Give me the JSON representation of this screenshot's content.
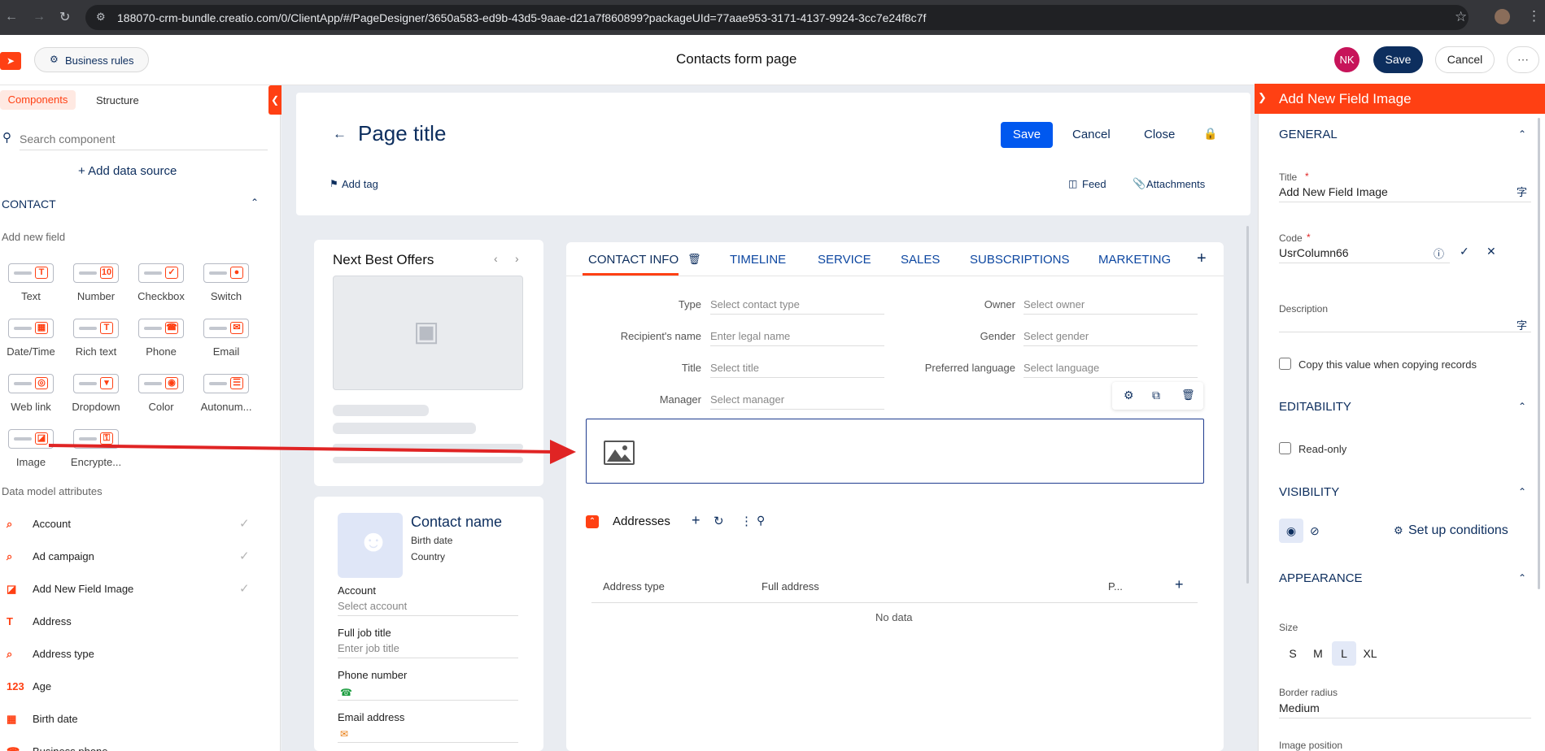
{
  "browser": {
    "url": "188070-crm-bundle.creatio.com/0/ClientApp/#/PageDesigner/3650a583-ed9b-43d5-9aae-d21a7f860899?packageUId=77aae953-3171-4137-9924-3cc7e24f8c7f"
  },
  "header": {
    "business_rules": "Business rules",
    "title": "Contacts form page",
    "avatar": "NK",
    "save": "Save",
    "cancel": "Cancel",
    "more": "⋯"
  },
  "left": {
    "tabs": [
      "Components",
      "Structure"
    ],
    "search_placeholder": "Search component",
    "add_data_source": "+ Add data source",
    "section": "CONTACT",
    "add_new_field": "Add new field",
    "components": [
      {
        "label": "Text",
        "mark": "T"
      },
      {
        "label": "Number",
        "mark": "10"
      },
      {
        "label": "Checkbox",
        "mark": "✓"
      },
      {
        "label": "Switch",
        "mark": "●"
      },
      {
        "label": "Date/Time",
        "mark": "▦"
      },
      {
        "label": "Rich text",
        "mark": "T"
      },
      {
        "label": "Phone",
        "mark": "☎"
      },
      {
        "label": "Email",
        "mark": "✉"
      },
      {
        "label": "Web link",
        "mark": "◎"
      },
      {
        "label": "Dropdown",
        "mark": "▾"
      },
      {
        "label": "Color",
        "mark": "◉"
      },
      {
        "label": "Autonum...",
        "mark": "☰"
      },
      {
        "label": "Image",
        "mark": "◪"
      },
      {
        "label": "Encrypte...",
        "mark": "⚿"
      }
    ],
    "data_model_title": "Data model attributes",
    "attributes": [
      {
        "icon": "⌕",
        "label": "Account",
        "checked": true
      },
      {
        "icon": "⌕",
        "label": "Ad campaign",
        "checked": true
      },
      {
        "icon": "◪",
        "label": "Add New Field Image",
        "checked": true
      },
      {
        "icon": "T",
        "label": "Address",
        "checked": false
      },
      {
        "icon": "⌕",
        "label": "Address type",
        "checked": false
      },
      {
        "icon": "123",
        "label": "Age",
        "checked": false
      },
      {
        "icon": "▦",
        "label": "Birth date",
        "checked": false
      },
      {
        "icon": "☎",
        "label": "Business phone",
        "checked": false
      }
    ]
  },
  "page": {
    "title": "Page title",
    "save": "Save",
    "cancel": "Cancel",
    "close": "Close",
    "add_tag": "Add tag",
    "feed": "Feed",
    "attachments": "Attachments",
    "nbo_title": "Next Best Offers",
    "contact_name": "Contact name",
    "birth_date": "Birth date",
    "country": "Country",
    "profile_fields": [
      {
        "label": "Account",
        "placeholder": "Select account"
      },
      {
        "label": "Full job title",
        "placeholder": "Enter job title"
      },
      {
        "label": "Phone number",
        "placeholder": ""
      },
      {
        "label": "Email address",
        "placeholder": ""
      }
    ],
    "tabs": [
      "CONTACT INFO",
      "TIMELINE",
      "SERVICE",
      "SALES",
      "SUBSCRIPTIONS",
      "MARKETING"
    ],
    "left_fields": [
      {
        "label": "Type",
        "placeholder": "Select contact type"
      },
      {
        "label": "Recipient's name",
        "placeholder": "Enter legal name"
      },
      {
        "label": "Title",
        "placeholder": "Select title"
      },
      {
        "label": "Manager",
        "placeholder": "Select manager"
      }
    ],
    "right_fields": [
      {
        "label": "Owner",
        "placeholder": "Select owner"
      },
      {
        "label": "Gender",
        "placeholder": "Select gender"
      },
      {
        "label": "Preferred language",
        "placeholder": "Select language"
      }
    ],
    "addresses_title": "Addresses",
    "columns": [
      "Address type",
      "Full address",
      "P..."
    ],
    "no_data": "No data"
  },
  "right": {
    "header": "Add New Field Image",
    "general": "GENERAL",
    "title_label": "Title",
    "title_value": "Add New Field Image",
    "code_label": "Code",
    "code_value": "UsrColumn66",
    "description_label": "Description",
    "copy_label": "Copy this value when copying records",
    "editability": "EDITABILITY",
    "read_only": "Read-only",
    "visibility": "VISIBILITY",
    "setup_conditions": "Set up conditions",
    "appearance": "APPEARANCE",
    "size_label": "Size",
    "sizes": [
      "S",
      "M",
      "L",
      "XL"
    ],
    "selected_size": "L",
    "border_radius_label": "Border radius",
    "border_radius_value": "Medium",
    "image_position_label": "Image position"
  },
  "colors": {
    "accent": "#ff4013",
    "primary": "#0058ef",
    "navy": "#0d2e5e",
    "arrow": "#e02424"
  }
}
